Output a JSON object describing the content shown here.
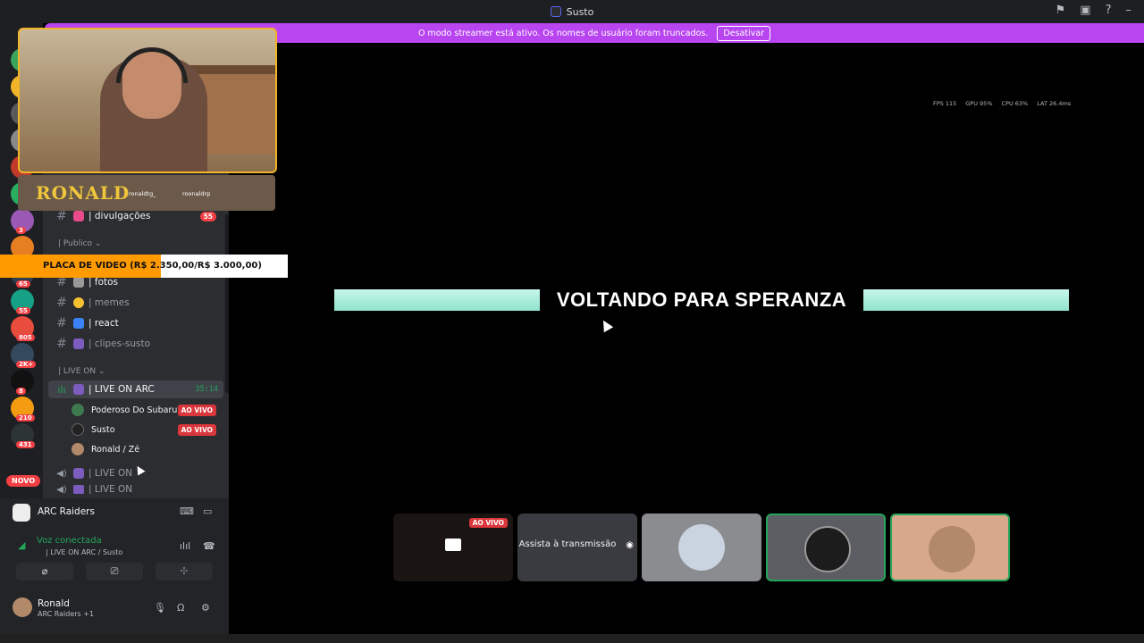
{
  "window": {
    "title": "Susto"
  },
  "banner": {
    "text": "O modo streamer está ativo. Os nomes de usuário foram truncados.",
    "button": "Desativar"
  },
  "servers": [
    {
      "color": "#3ba55c",
      "badge": ""
    },
    {
      "color": "#f0b429",
      "badge": ""
    },
    {
      "color": "#5a5a5a",
      "badge": ""
    },
    {
      "color": "#888888",
      "badge": ""
    },
    {
      "color": "#c0392b",
      "badge": ""
    },
    {
      "color": "#27ae60",
      "badge": ""
    },
    {
      "color": "#9b59b6",
      "badge": "3"
    },
    {
      "color": "#e67e22",
      "badge": ""
    },
    {
      "color": "#2c3e50",
      "badge": "65"
    },
    {
      "color": "#16a085",
      "badge": "55"
    },
    {
      "color": "#e74c3c",
      "badge": "805"
    },
    {
      "color": "#34495e",
      "badge": "2K+"
    },
    {
      "color": "#111111",
      "badge": "8"
    },
    {
      "color": "#f39c12",
      "badge": "210"
    },
    {
      "color": "#2d3436",
      "badge": "431"
    }
  ],
  "novo_label": "NOVO",
  "webcam": {
    "name": "RONALD",
    "handle1": "ronaldtg_",
    "handle2": "roonaldrp"
  },
  "price_banner": {
    "text": "PLACA DE VIDEO (R$ 2.350,00/R$ 3.000,00)"
  },
  "channels": {
    "divulgacoes": {
      "name": "| divulgações",
      "count": "55"
    },
    "cat_publico": "| Publico ⌄",
    "fotos": "| fotos",
    "memes": "| memes",
    "react": "| react",
    "clipes": "| clipes-susto",
    "cat_liveon": "| LIVE ON ⌄",
    "live_on_arc": {
      "name": "| LIVE ON ARC",
      "time": "35:14"
    },
    "members": [
      {
        "name": "Poderoso Do Subaru",
        "live": "AO VIVO"
      },
      {
        "name": "Susto",
        "live": "AO VIVO"
      },
      {
        "name": "Ronald / Zé",
        "live": ""
      }
    ],
    "live_on": "| LIVE ON",
    "live_on_cut": "| LIVE ON"
  },
  "panel": {
    "server_name": "ARC Raiders",
    "voice_status": "Voz conectada",
    "voice_channel": "| LIVE ON ARC / Susto",
    "user_name": "Ronald",
    "user_sub": "ARC Raiders +1"
  },
  "stats": {
    "fps": "FPS 115",
    "gpu": "GPU 95%",
    "cpu": "CPU 63%",
    "lat": "LAT 26.4ms"
  },
  "stage": {
    "headline": "VOLTANDO PARA SPERANZA"
  },
  "tiles": {
    "live_tag": "AO VIVO",
    "watch_label": "Assista à transmissão"
  },
  "colors": {
    "accent_purple": "#b845f0",
    "green": "#23a55a",
    "red": "#da373c",
    "teal_bar": "#8ee3cc",
    "orange": "#ff9a00"
  }
}
